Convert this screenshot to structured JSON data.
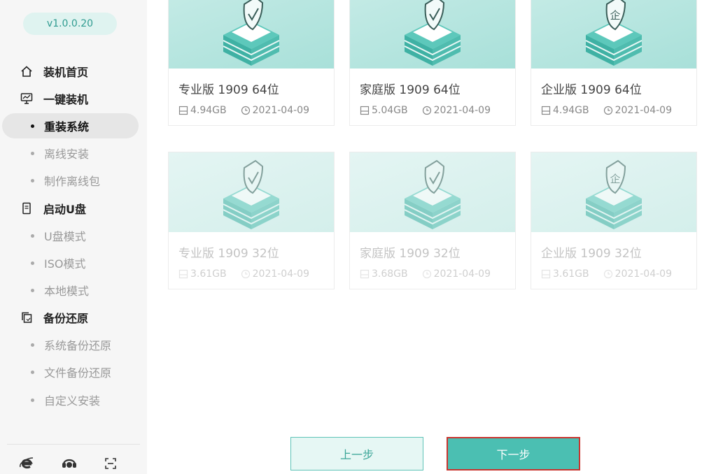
{
  "sidebar": {
    "version": "v1.0.0.20",
    "items": [
      {
        "type": "top",
        "icon": "home-icon",
        "label": "装机首页"
      },
      {
        "type": "top",
        "icon": "monitor-icon",
        "label": "一键装机"
      },
      {
        "type": "sub",
        "label": "重装系统",
        "active": true
      },
      {
        "type": "sub",
        "label": "离线安装"
      },
      {
        "type": "sub",
        "label": "制作离线包"
      },
      {
        "type": "top",
        "icon": "usb-icon",
        "label": "启动U盘"
      },
      {
        "type": "sub",
        "label": "U盘模式"
      },
      {
        "type": "sub",
        "label": "ISO模式"
      },
      {
        "type": "sub",
        "label": "本地模式"
      },
      {
        "type": "top",
        "icon": "backup-icon",
        "label": "备份还原"
      },
      {
        "type": "sub",
        "label": "系统备份还原"
      },
      {
        "type": "sub",
        "label": "文件备份还原"
      },
      {
        "type": "sub",
        "label": "自定义安装"
      }
    ],
    "bottom_icons": [
      "browser-icon",
      "support-icon",
      "scan-icon"
    ]
  },
  "systems": [
    {
      "title": "专业版 1909 64位",
      "size": "4.94GB",
      "date": "2021-04-09",
      "badge": "check"
    },
    {
      "title": "家庭版 1909 64位",
      "size": "5.04GB",
      "date": "2021-04-09",
      "badge": "check"
    },
    {
      "title": "企业版 1909 64位",
      "size": "4.94GB",
      "date": "2021-04-09",
      "badge": "企"
    },
    {
      "title": "专业版 1909 32位",
      "size": "3.61GB",
      "date": "2021-04-09",
      "badge": "check"
    },
    {
      "title": "家庭版 1909 32位",
      "size": "3.68GB",
      "date": "2021-04-09",
      "badge": "check"
    },
    {
      "title": "企业版 1909 32位",
      "size": "3.61GB",
      "date": "2021-04-09",
      "badge": "企"
    }
  ],
  "buttons": {
    "prev": "上一步",
    "next": "下一步"
  },
  "colors": {
    "accent": "#4bbfb2",
    "highlight_border": "#c9342f"
  }
}
